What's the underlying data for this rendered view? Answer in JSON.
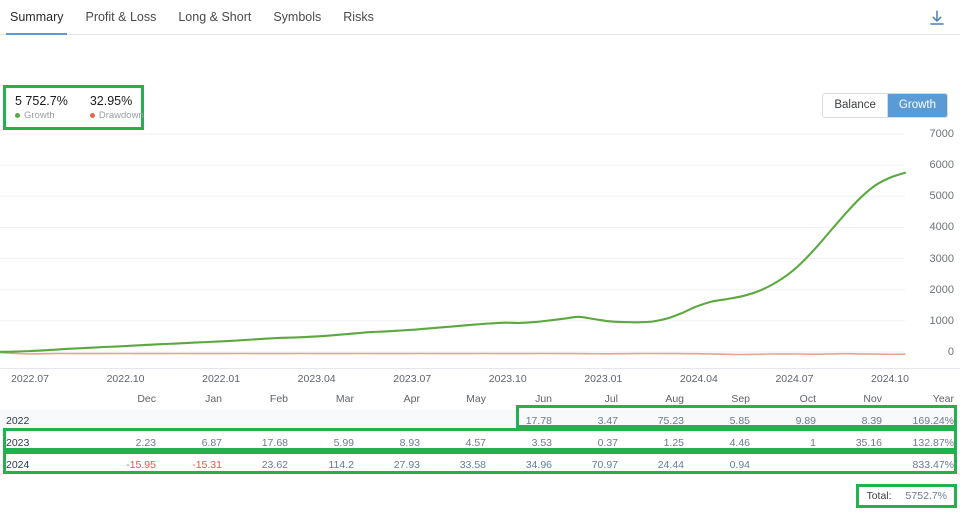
{
  "tabs": [
    {
      "label": "Summary",
      "active": true
    },
    {
      "label": "Profit & Loss",
      "active": false
    },
    {
      "label": "Long & Short",
      "active": false
    },
    {
      "label": "Symbols",
      "active": false
    },
    {
      "label": "Risks",
      "active": false
    }
  ],
  "toolbar": {
    "download_icon": "download-icon"
  },
  "stats": {
    "growth_value": "5 752.7%",
    "growth_label": "Growth",
    "drawdown_value": "32.95%",
    "drawdown_label": "Drawdown"
  },
  "view_toggle": {
    "options": [
      "Balance",
      "Growth"
    ],
    "selected": "Growth"
  },
  "colors": {
    "growth_line": "#5ba83f",
    "drawdown_line": "#e8a48c",
    "accent_blue": "#5b9bd5",
    "highlight_green": "#22b14c",
    "negative_red": "#e0564a"
  },
  "chart_data": {
    "type": "line",
    "title": "",
    "xlabel": "",
    "ylabel": "",
    "ylim": [
      0,
      7000
    ],
    "ytick_labels": [
      "7000",
      "6000",
      "5000",
      "4000",
      "3000",
      "2000",
      "1000",
      "0"
    ],
    "yticks": [
      7000,
      6000,
      5000,
      4000,
      3000,
      2000,
      1000,
      0
    ],
    "xtick_labels": [
      "2022.07",
      "2022.10",
      "2022.01",
      "2023.04",
      "2023.07",
      "2023.10",
      "2023.01",
      "2024.04",
      "2024.07",
      "2024.10"
    ],
    "grid": true,
    "legend_position": "top-left",
    "series": [
      {
        "name": "Growth",
        "color": "#5ba83f",
        "values": [
          5,
          12,
          30,
          55,
          85,
          110,
          135,
          160,
          180,
          205,
          230,
          255,
          275,
          300,
          320,
          345,
          370,
          400,
          430,
          455,
          470,
          490,
          520,
          560,
          600,
          640,
          660,
          690,
          720,
          760,
          800,
          840,
          880,
          915,
          940,
          930,
          960,
          1010,
          1070,
          1130,
          1060,
          990,
          960,
          955,
          980,
          1080,
          1260,
          1470,
          1620,
          1700,
          1790,
          1930,
          2150,
          2450,
          2850,
          3350,
          3900,
          4450,
          4950,
          5350,
          5600,
          5752.7
        ]
      },
      {
        "name": "Drawdown",
        "color": "#e8a48c",
        "values": [
          -20,
          -45,
          -60,
          -55,
          -48,
          -50,
          -52,
          -50,
          -48,
          -50,
          -52,
          -50,
          -48,
          -50,
          -52,
          -50,
          -48,
          -50,
          -52,
          -50,
          -48,
          -50,
          -52,
          -50,
          -48,
          -50,
          -52,
          -50,
          -48,
          -50,
          -52,
          -50,
          -48,
          -50,
          -52,
          -50,
          -48,
          -50,
          -52,
          -55,
          -58,
          -55,
          -50,
          -48,
          -50,
          -52,
          -55,
          -60,
          -70,
          -80,
          -75,
          -65,
          -60,
          -65,
          -70,
          -62,
          -55,
          -60,
          -68,
          -75,
          -70
        ]
      }
    ]
  },
  "table": {
    "columns": [
      "",
      "Dec",
      "Jan",
      "Feb",
      "Mar",
      "Apr",
      "May",
      "Jun",
      "Jul",
      "Aug",
      "Sep",
      "Oct",
      "Nov",
      "Year"
    ],
    "rows": [
      {
        "year": "2022",
        "values": [
          "",
          "",
          "",
          "",
          "",
          "",
          "17.78",
          "3.47",
          "75.23",
          "5.85",
          "9.89",
          "8.39"
        ],
        "total": "169.24%",
        "negative_flags": [
          false,
          false,
          false,
          false,
          false,
          false,
          false,
          false,
          false,
          false,
          false,
          false
        ]
      },
      {
        "year": "2023",
        "values": [
          "2.23",
          "6.87",
          "17.68",
          "5.99",
          "8.93",
          "4.57",
          "3.53",
          "0.37",
          "1.25",
          "4.46",
          "1",
          "35.16"
        ],
        "total": "132.87%",
        "negative_flags": [
          false,
          false,
          false,
          false,
          false,
          false,
          false,
          false,
          false,
          false,
          false,
          false
        ]
      },
      {
        "year": "2024",
        "values": [
          "-15.95",
          "-15.31",
          "23.62",
          "114.2",
          "27.93",
          "33.58",
          "34.96",
          "70.97",
          "24.44",
          "0.94",
          "",
          ""
        ],
        "total": "833.47%",
        "negative_flags": [
          true,
          true,
          false,
          false,
          false,
          false,
          false,
          false,
          false,
          false,
          false,
          false
        ]
      }
    ],
    "total_label": "Total:",
    "total_value": "5752.7%"
  }
}
